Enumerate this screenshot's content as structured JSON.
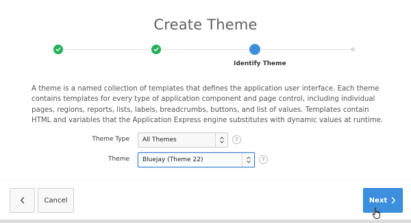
{
  "wizard": {
    "title": "Create Theme",
    "steps": [
      {
        "state": "complete",
        "label": ""
      },
      {
        "state": "complete",
        "label": ""
      },
      {
        "state": "current",
        "label": "Identify Theme"
      },
      {
        "state": "pending",
        "label": ""
      }
    ],
    "description": "A theme is a named collection of templates that defines the application user interface. Each theme contains templates for every type of application component and page control, including individual pages, regions, reports, lists, labels, breadcrumbs, buttons, and list of values. Templates contain HTML and variables that the Application Express engine substitutes with dynamic values at runtime."
  },
  "form": {
    "theme_type": {
      "label": "Theme Type",
      "value": "All Themes",
      "help": "?"
    },
    "theme": {
      "label": "Theme",
      "value": "Bluejay (Theme 22)",
      "help": "?"
    }
  },
  "footer": {
    "back_icon": "chevron-left-icon",
    "cancel_label": "Cancel",
    "next_label": "Next",
    "next_icon": "chevron-right-icon"
  },
  "colors": {
    "accent": "#3c8fdc",
    "complete": "#26b05b",
    "pending": "#dadada"
  }
}
